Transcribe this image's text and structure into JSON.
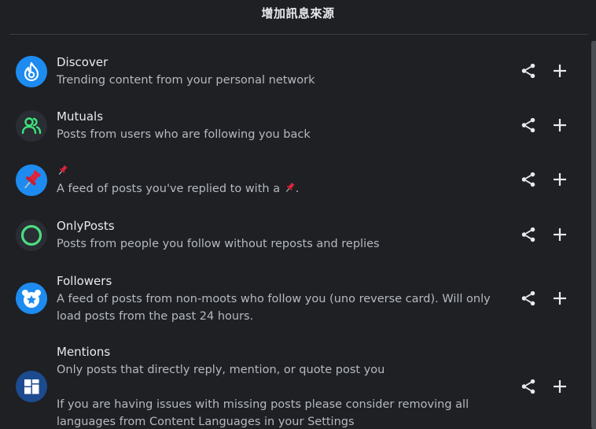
{
  "dialog": {
    "title": "增加訊息來源"
  },
  "feeds": [
    {
      "name": "Discover",
      "description": "Trending content from your personal network",
      "icon": "discover-flame-icon",
      "color": "#1d8bf0"
    },
    {
      "name": "Mutuals",
      "description": "Posts from users who are following you back",
      "icon": "mutuals-people-icon",
      "color": "#3ee27c"
    },
    {
      "name": "📌",
      "description_prefix": "A feed of posts you've replied to with a ",
      "description_suffix": ".",
      "icon": "pushpin-icon",
      "color": "#1d8bf0"
    },
    {
      "name": "OnlyPosts",
      "description": "Posts from people you follow without reposts and replies",
      "icon": "ring-icon",
      "color": "#4ade80"
    },
    {
      "name": "Followers",
      "description": "A feed of posts from non-moots who follow you (uno reverse card). Will only load posts from the past 24 hours.",
      "icon": "followers-bear-icon",
      "color": "#1d8bf0"
    },
    {
      "name": "Mentions",
      "description": "Only posts that directly reply, mention, or quote post you",
      "description_extra": "If you are having issues with missing posts please consider removing all languages from Content Languages in your Settings",
      "icon": "mentions-grid-icon",
      "color": "#1d4b8f"
    }
  ],
  "colors": {
    "background": "#1e2024",
    "text_primary": "#e8eaed",
    "text_secondary": "#b5b9c0",
    "accent_blue": "#1d8bf0"
  }
}
